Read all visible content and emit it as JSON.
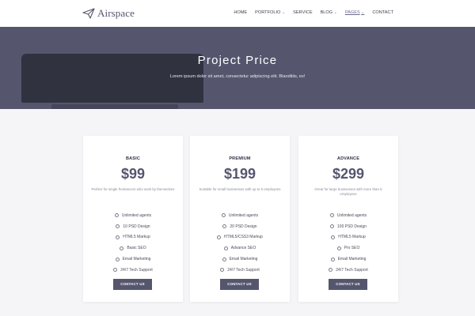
{
  "brand": {
    "name": "Airspace",
    "logo_icon": "paper-plane-icon"
  },
  "nav": {
    "items": [
      {
        "label": "HOME",
        "dropdown": false,
        "active": false
      },
      {
        "label": "PORTFOLIO",
        "dropdown": true,
        "active": false
      },
      {
        "label": "SERVICE",
        "dropdown": false,
        "active": false
      },
      {
        "label": "BLOG",
        "dropdown": true,
        "active": false
      },
      {
        "label": "PAGES",
        "dropdown": true,
        "active": true
      },
      {
        "label": "CONTACT",
        "dropdown": false,
        "active": false
      }
    ]
  },
  "hero": {
    "title": "Project Price",
    "subtitle": "Lorem ipsum dolor sit amet, consectetur adipiscing elit. Blanditiis, ex!"
  },
  "plans": [
    {
      "name": "BASIC",
      "price": "$99",
      "description": "Perfect for single freelancers who work by themselves",
      "features": [
        "Unlimited agents",
        "10 PSD Design",
        "HTML5 Markup",
        "Basic SEO",
        "Email Marketing",
        "24/7 Tech Support"
      ],
      "button": "CONTACT US"
    },
    {
      "name": "PREMIUM",
      "price": "$199",
      "description": "Suitable for small businesses with up to 5 employees",
      "features": [
        "Unlimited agents",
        "20 PSD Design",
        "HTML5/CSS3 Markup",
        "Advance SEO",
        "Email Marketing",
        "24/7 Tech Support"
      ],
      "button": "CONTACT US"
    },
    {
      "name": "ADVANCE",
      "price": "$299",
      "description": "Great for large businesses with more than 5 employees",
      "features": [
        "Unlimited agents",
        "100 PSD Design",
        "HTML5 Markup",
        "Pro SEO",
        "Email Marketing",
        "24/7 Tech Support"
      ],
      "button": "CONTACT US"
    }
  ],
  "colors": {
    "accent": "#55566e",
    "text": "#2f3040",
    "muted": "#8a8b98",
    "background": "#f5f5f7"
  }
}
